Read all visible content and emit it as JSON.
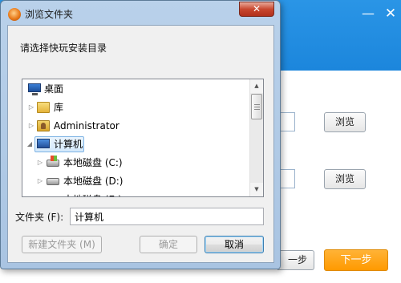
{
  "background_window": {
    "minimize_glyph": "—",
    "close_glyph": "✕",
    "browse_button_1": "浏览",
    "browse_button_2": "浏览",
    "prev_button": "一步",
    "next_button": "下一步",
    "accent_color": "#1e88df",
    "next_color": "#ffa21a"
  },
  "dialog": {
    "title": "浏览文件夹",
    "close_glyph": "✕",
    "prompt": "请选择快玩安装目录",
    "tree": {
      "items": [
        {
          "label": "桌面",
          "icon": "desktop-icon",
          "expander": ""
        },
        {
          "label": "库",
          "icon": "library-icon",
          "expander": "▷"
        },
        {
          "label": "Administrator",
          "icon": "user-folder-icon",
          "expander": "▷"
        },
        {
          "label": "计算机",
          "icon": "computer-icon",
          "expander": "◢",
          "selected": true
        },
        {
          "label": "本地磁盘 (C:)",
          "icon": "system-drive-icon",
          "expander": "▷"
        },
        {
          "label": "本地磁盘 (D:)",
          "icon": "drive-icon",
          "expander": "▷"
        },
        {
          "label": "本地磁盘 (E:)",
          "icon": "drive-icon",
          "expander": "▷"
        }
      ],
      "scroll_up_glyph": "▲",
      "scroll_down_glyph": "▼"
    },
    "folder_label": "文件夹 (F):",
    "folder_value": "计算机",
    "new_folder_button": "新建文件夹 (M)",
    "ok_button": "确定",
    "cancel_button": "取消"
  }
}
